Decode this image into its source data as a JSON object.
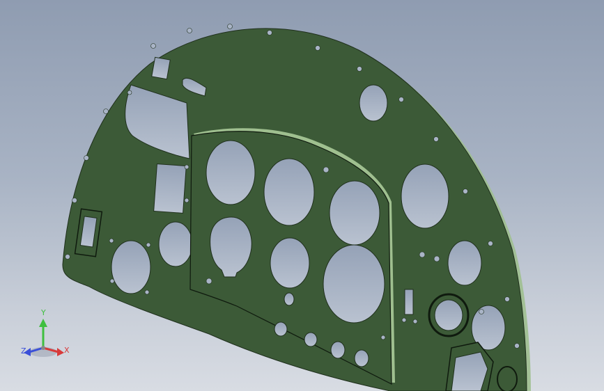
{
  "viewport": {
    "background_top": "#8f9cb1",
    "background_bottom": "#d8dce3"
  },
  "model": {
    "panel_color": "#3c5a37",
    "panel_edge_color": "#9fbf8f",
    "hole_color": "#a9b4c6"
  },
  "triad": {
    "x_label": "X",
    "y_label": "Y",
    "z_label": "Z",
    "x_color": "#d83a3a",
    "y_color": "#3fbf3f",
    "z_color": "#3a4fd8"
  }
}
